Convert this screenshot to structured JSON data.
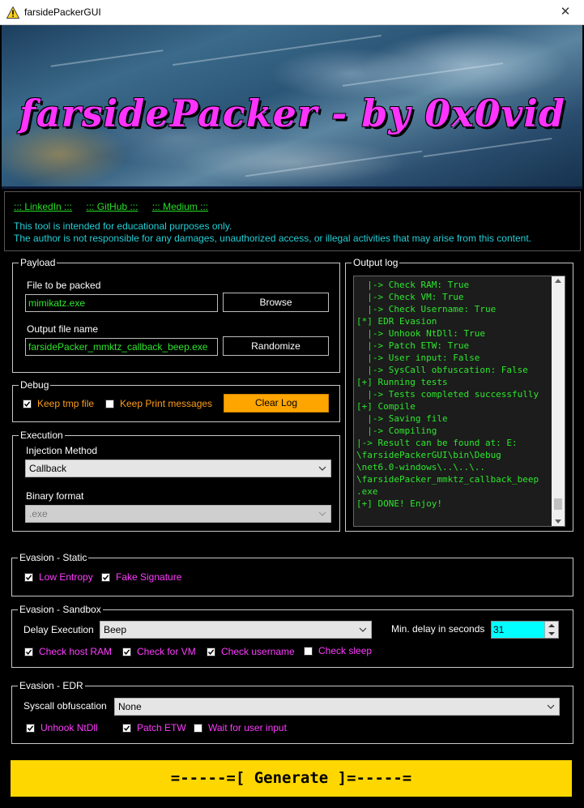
{
  "window": {
    "title": "farsidePackerGUI",
    "close_glyph": "✕"
  },
  "banner": {
    "title": "farsidePacker - by 0x0vid"
  },
  "links": [
    "::: LinkedIn :::",
    "::: GitHub :::",
    "::: Medium :::"
  ],
  "disclaimer": [
    "This tool is intended for educational purposes only.",
    "The author is not responsible for any damages, unauthorized access, or illegal activities that may arise from this content."
  ],
  "payload": {
    "legend": "Payload",
    "file_label": "File to be packed",
    "file_value": "mimikatz.exe",
    "browse": "Browse",
    "output_label": "Output file name",
    "output_value": "farsidePacker_mmktz_callback_beep.exe",
    "randomize": "Randomize"
  },
  "debug": {
    "legend": "Debug",
    "keep_tmp": {
      "label": "Keep tmp file",
      "checked": true
    },
    "keep_print": {
      "label": "Keep Print messages",
      "checked": false
    },
    "clear_log": "Clear Log"
  },
  "execution": {
    "legend": "Execution",
    "injection_label": "Injection Method",
    "injection_value": "Callback",
    "binary_label": "Binary format",
    "binary_value": ".exe"
  },
  "output_log": {
    "legend": "Output log",
    "lines": [
      "  |-> Check RAM: True",
      "  |-> Check VM: True",
      "  |-> Check Username: True",
      "[*] EDR Evasion",
      "  |-> Unhook NtDll: True",
      "  |-> Patch ETW: True",
      "  |-> User input: False",
      "  |-> SysCall obfuscation: False",
      "[+] Running tests",
      "  |-> Tests completed successfully",
      "[+] Compile",
      "  |-> Saving file",
      "  |-> Compiling",
      "|-> Result can be found at: E:",
      "\\farsidePackerGUI\\bin\\Debug",
      "\\net6.0-windows\\..\\..\\..",
      "\\farsidePacker_mmktz_callback_beep",
      ".exe",
      "[+] DONE! Enjoy!"
    ]
  },
  "evasion_static": {
    "legend": "Evasion - Static",
    "low_entropy": {
      "label": "Low Entropy",
      "checked": true
    },
    "fake_signature": {
      "label": "Fake Signature",
      "checked": true
    }
  },
  "evasion_sandbox": {
    "legend": "Evasion - Sandbox",
    "delay_label": "Delay Execution",
    "delay_value": "Beep",
    "min_delay_label": "Min. delay in seconds",
    "min_delay_value": "31",
    "check_ram": {
      "label": "Check host RAM",
      "checked": true
    },
    "check_vm": {
      "label": "Check for VM",
      "checked": true
    },
    "check_user": {
      "label": "Check username",
      "checked": true
    },
    "check_sleep": {
      "label": "Check sleep",
      "checked": false
    }
  },
  "evasion_edr": {
    "legend": "Evasion - EDR",
    "syscall_label": "Syscall obfuscation",
    "syscall_value": "None",
    "unhook": {
      "label": "Unhook NtDll",
      "checked": true
    },
    "patch_etw": {
      "label": "Patch ETW",
      "checked": true
    },
    "wait_input": {
      "label": "Wait for user input",
      "checked": false
    }
  },
  "generate": "=-----=[ Generate ]=-----="
}
